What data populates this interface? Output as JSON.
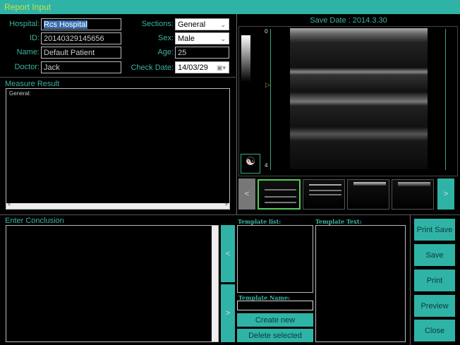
{
  "window": {
    "title": "Report Input"
  },
  "form": {
    "hospital": {
      "label": "Hospital:",
      "value": "Rcs Hospital"
    },
    "id": {
      "label": "ID:",
      "value": "20140329145656"
    },
    "name": {
      "label": "Name:",
      "value": "Default Patient"
    },
    "doctor": {
      "label": "Doctor:",
      "value": "Jack"
    },
    "sections": {
      "label": "Sections:",
      "value": "General"
    },
    "sex": {
      "label": "Sex:",
      "value": "Male"
    },
    "age": {
      "label": "Age:",
      "value": "25"
    },
    "check_date": {
      "label": "Check Date:",
      "value": "14/03/29"
    }
  },
  "measure": {
    "label": "Measure Result",
    "content": "General:"
  },
  "image": {
    "save_date": "Save Date : 2014.3.30",
    "depth_top": "0",
    "depth_bottom": "4",
    "prev": "<",
    "next": ">"
  },
  "conclusion": {
    "label": "Enter Conclusion",
    "left": "<",
    "right": ">"
  },
  "templates": {
    "list_label": "Template list:",
    "text_label": "Template Text:",
    "name_label": "Template Name:",
    "create": "Create new",
    "delete": "Delete selected"
  },
  "actions": {
    "print_save": "Print Save",
    "save": "Save",
    "print": "Print",
    "preview": "Preview",
    "close": "Close"
  }
}
